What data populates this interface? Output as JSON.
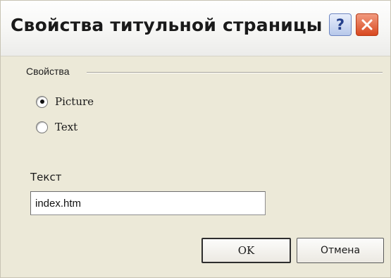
{
  "window": {
    "title": "Свойства титульной страницы",
    "help_glyph": "?",
    "help_icon": "question-mark-icon",
    "close_icon": "close-x-icon"
  },
  "group": {
    "label": "Свойства"
  },
  "radios": [
    {
      "label": "Picture",
      "selected": true
    },
    {
      "label": "Text",
      "selected": false
    }
  ],
  "text_field": {
    "label": "Текст",
    "value": "index.htm"
  },
  "buttons": {
    "ok_label": "OK",
    "cancel_label": "Отмена"
  },
  "colors": {
    "dialog_bg": "#ece9d8",
    "close_button": "#d8481f",
    "help_button": "#b7c8ea"
  }
}
